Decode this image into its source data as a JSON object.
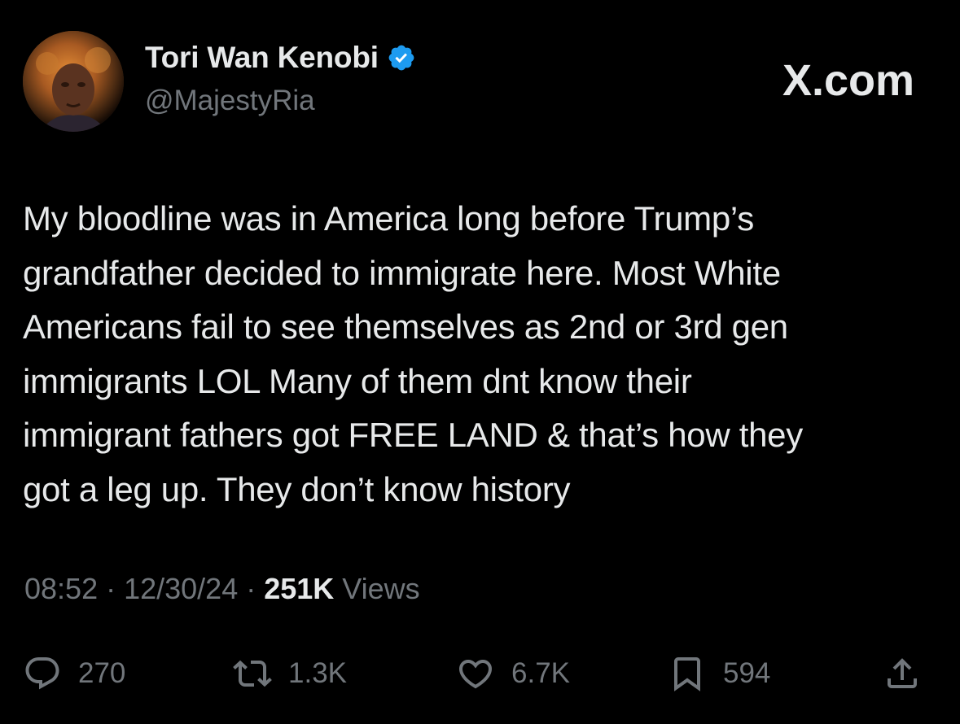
{
  "author": {
    "display_name": "Tori Wan Kenobi",
    "handle": "@MajestyRia",
    "verified": true,
    "verified_color": "#1d9bf0"
  },
  "source_label": "X.com",
  "tweet": {
    "text": "My bloodline was in America long before Trump’s\ngrandfather decided to immigrate here. Most White\nAmericans fail to see themselves as 2nd or 3rd gen\nimmigrants LOL Many of them dnt know their\nimmigrant fathers got FREE LAND & that’s how they\ngot a leg up. They don’t know history"
  },
  "meta": {
    "time": "08:52",
    "separator": " · ",
    "date": "12/30/24",
    "views_count": "251K",
    "views_label": " Views"
  },
  "actions": {
    "replies": {
      "icon": "reply-icon",
      "count": "270"
    },
    "reposts": {
      "icon": "repost-icon",
      "count": "1.3K"
    },
    "likes": {
      "icon": "heart-icon",
      "count": "6.7K"
    },
    "bookmarks": {
      "icon": "bookmark-icon",
      "count": "594"
    },
    "share": {
      "icon": "share-icon"
    }
  },
  "colors": {
    "background": "#000000",
    "primary_text": "#e7e9ea",
    "secondary_text": "#71767b"
  }
}
